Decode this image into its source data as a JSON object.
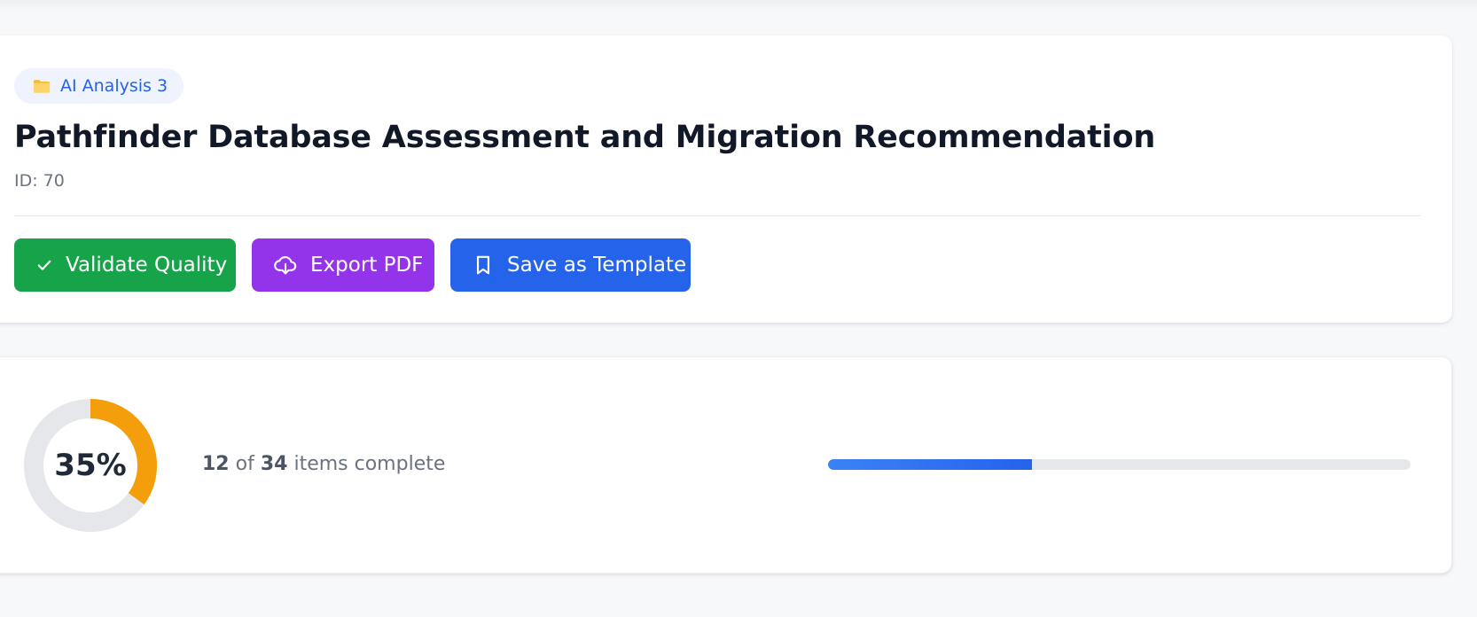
{
  "header": {
    "badge_label": "AI Analysis 3",
    "badge_icon": "folder-icon",
    "title": "Pathfinder Database Assessment and Migration Recommendation",
    "id_text": "ID: 70"
  },
  "actions": {
    "validate": {
      "label": "Validate Quality",
      "icon": "check-icon",
      "color": "#16a34a"
    },
    "export": {
      "label": "Export PDF",
      "icon": "cloud-download-icon",
      "color": "#9333ea"
    },
    "template": {
      "label": "Save as Template",
      "icon": "bookmark-icon",
      "color": "#2563eb"
    }
  },
  "progress": {
    "percent_label": "35%",
    "fraction": 0.35,
    "completed": "12",
    "of_word": "of",
    "total": "34",
    "suffix": "items complete",
    "ring_color": "#f59e0b",
    "bar_color": "#2563eb"
  }
}
